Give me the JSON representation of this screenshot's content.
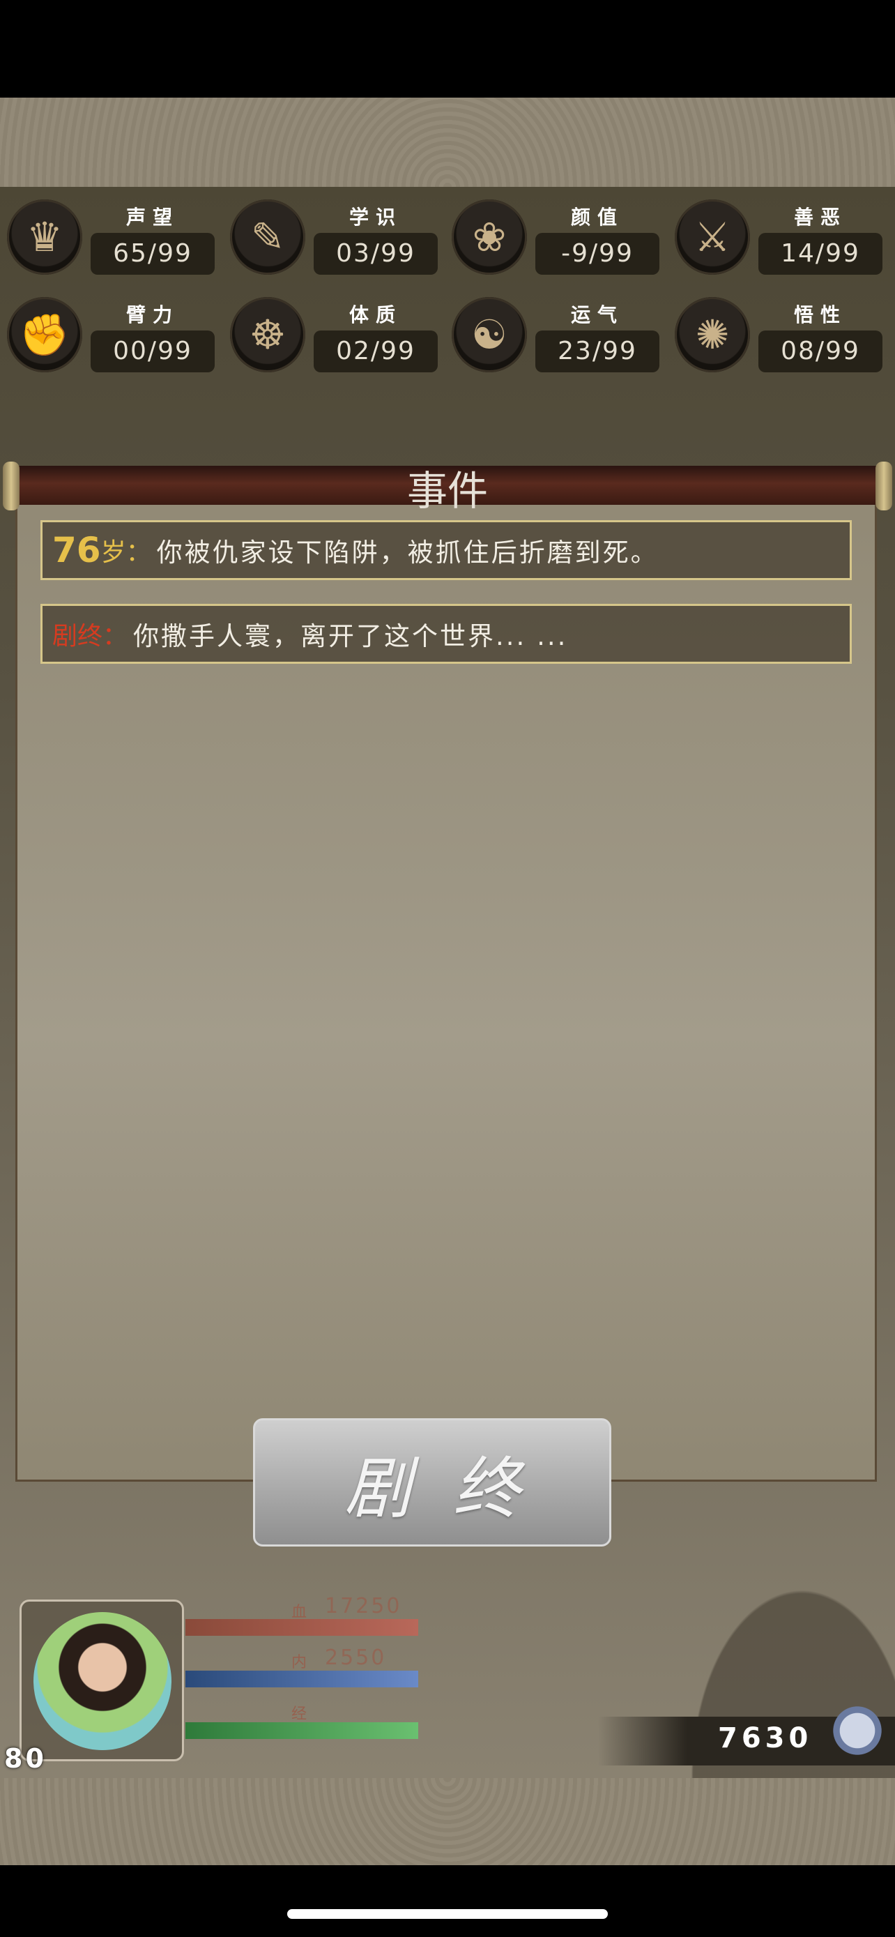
{
  "stats": [
    {
      "name": "声望",
      "value": "65/99",
      "icon": "reputation-icon",
      "glyph": "♛"
    },
    {
      "name": "学识",
      "value": "03/99",
      "icon": "scroll-icon",
      "glyph": "✎"
    },
    {
      "name": "颜值",
      "value": "-9/99",
      "icon": "fan-icon",
      "glyph": "❀"
    },
    {
      "name": "善恶",
      "value": "14/99",
      "icon": "crossed-swords-icon",
      "glyph": "⚔"
    },
    {
      "name": "臂力",
      "value": "00/99",
      "icon": "fist-icon",
      "glyph": "✊"
    },
    {
      "name": "体质",
      "value": "02/99",
      "icon": "body-icon",
      "glyph": "☸"
    },
    {
      "name": "运气",
      "value": "23/99",
      "icon": "coin-pouch-icon",
      "glyph": "☯"
    },
    {
      "name": "悟性",
      "value": "08/99",
      "icon": "brain-icon",
      "glyph": "✺"
    }
  ],
  "panel": {
    "title": "事件"
  },
  "events": [
    {
      "age": "76",
      "age_suffix": "岁：",
      "text": "你被仇家设下陷阱，被抓住后折磨到死。"
    },
    {
      "label": "剧终",
      "label_suffix": "：",
      "text": "你撒手人寰，离开了这个世界... ..."
    }
  ],
  "end_button": {
    "label": "剧终"
  },
  "hud": {
    "level": "80",
    "hp_label": "血",
    "hp_value": "17250",
    "mp_label": "内",
    "mp_value": "2550",
    "xp_label": "经",
    "money": "7630"
  },
  "colors": {
    "accent_gold": "#e6c04a",
    "accent_red": "#d63b20"
  }
}
